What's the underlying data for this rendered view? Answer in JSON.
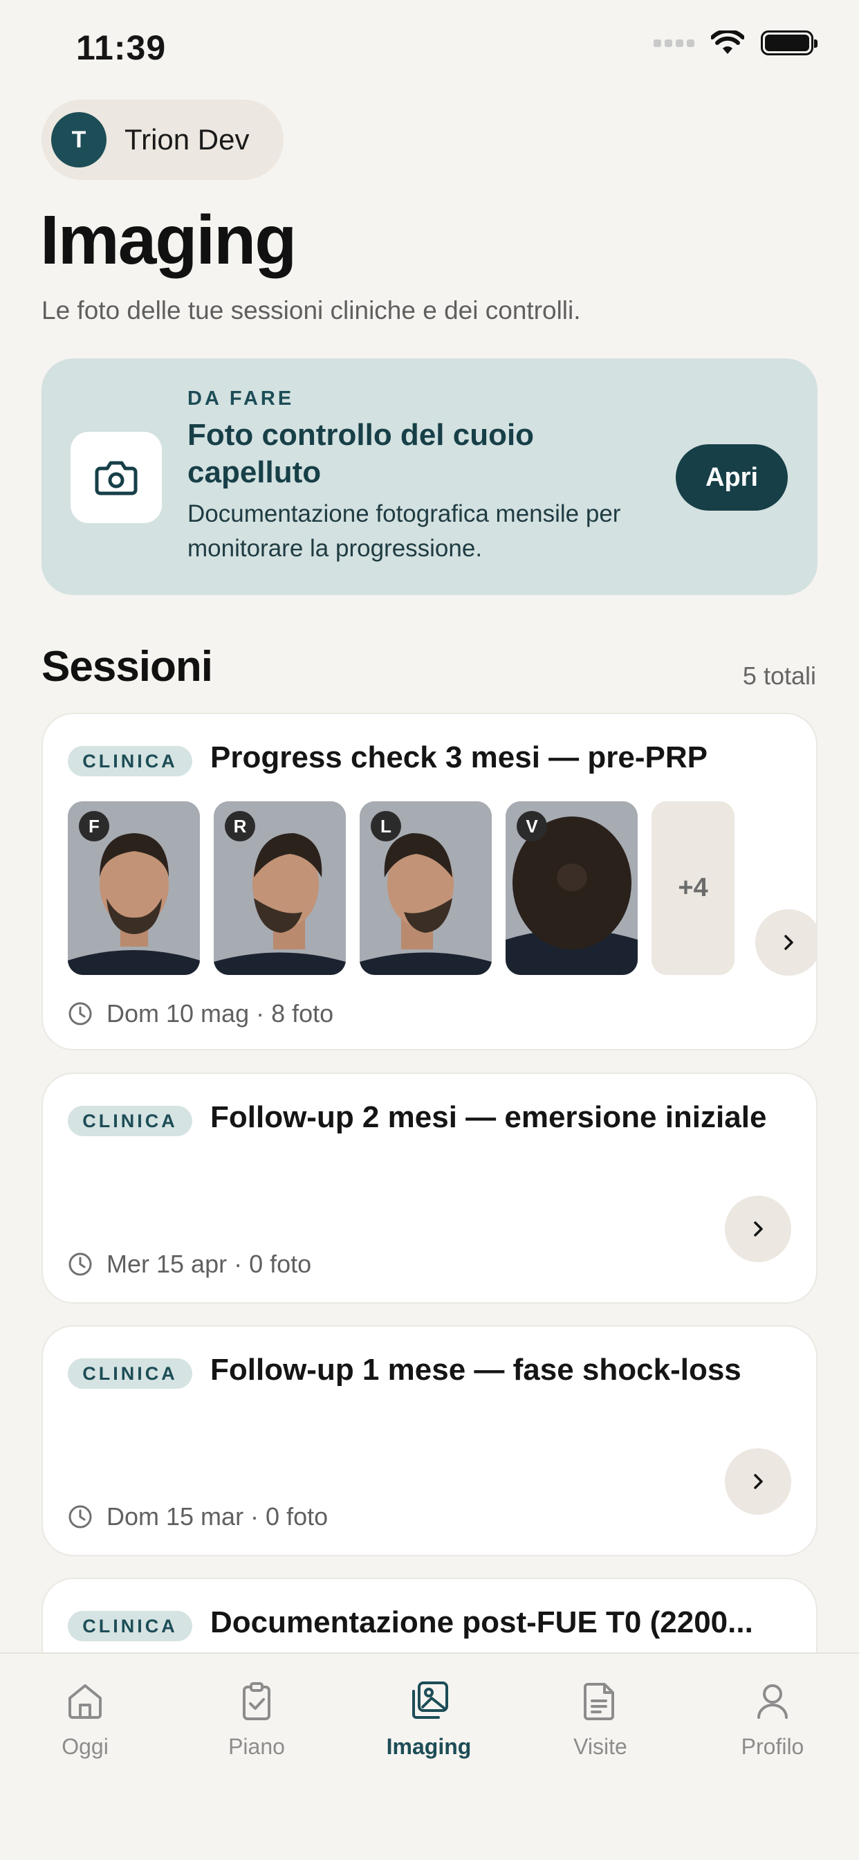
{
  "status_bar": {
    "time": "11:39"
  },
  "account": {
    "initial": "T",
    "name": "Trion Dev"
  },
  "page": {
    "title": "Imaging",
    "subtitle": "Le foto delle tue sessioni cliniche e dei controlli."
  },
  "task": {
    "eyebrow": "DA FARE",
    "title": "Foto controllo del cuoio capelluto",
    "description": "Documentazione fotografica mensile per monitorare la progressione.",
    "button_label": "Apri",
    "icon": "camera-icon"
  },
  "sessions": {
    "title": "Sessioni",
    "count": "5 totali",
    "items": [
      {
        "badge": "CLINICA",
        "title": "Progress check 3 mesi — pre-PRP",
        "meta": "Dom 10 mag · 8 foto",
        "thumbnails": [
          {
            "label": "F"
          },
          {
            "label": "R"
          },
          {
            "label": "L"
          },
          {
            "label": "V"
          }
        ],
        "more": "+4"
      },
      {
        "badge": "CLINICA",
        "title": "Follow-up 2 mesi — emersione iniziale",
        "meta": "Mer 15 apr · 0 foto"
      },
      {
        "badge": "CLINICA",
        "title": "Follow-up 1 mese — fase shock-loss",
        "meta": "Dom 15 mar · 0 foto"
      },
      {
        "badge": "CLINICA",
        "title": "Documentazione post-FUE T0 (2200..."
      }
    ]
  },
  "tab_bar": {
    "tabs": [
      {
        "label": "Oggi",
        "icon": "home-icon"
      },
      {
        "label": "Piano",
        "icon": "clipboard-check-icon"
      },
      {
        "label": "Imaging",
        "icon": "images-icon",
        "active": true
      },
      {
        "label": "Visite",
        "icon": "document-icon"
      },
      {
        "label": "Profilo",
        "icon": "user-icon"
      }
    ]
  },
  "colors": {
    "background": "#f5f4f0",
    "primary": "#173f48",
    "task_card": "#d3e1e0",
    "badge_bg": "#d5e3e2"
  }
}
